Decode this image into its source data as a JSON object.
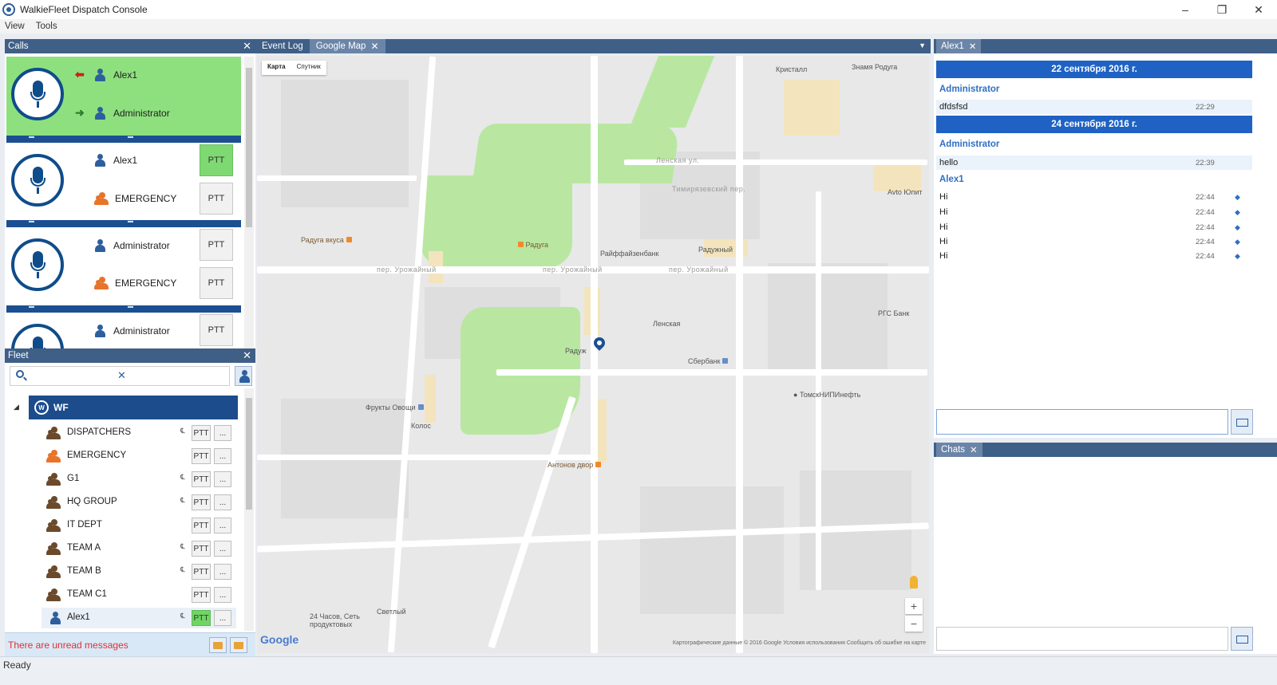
{
  "window": {
    "title": "WalkieFleet Dispatch Console"
  },
  "menu": [
    "View",
    "Tools"
  ],
  "calls": {
    "title": "Calls",
    "cards": [
      {
        "from": "Alex1",
        "to": "Administrator",
        "state": "active"
      },
      {
        "from": "Alex1",
        "to": "EMERGENCY",
        "ptt": [
          "PTT",
          "PTT"
        ]
      },
      {
        "from": "Administrator",
        "to": "EMERGENCY",
        "ptt": [
          "PTT",
          "PTT"
        ]
      },
      {
        "from": "Administrator",
        "ptt": [
          "PTT"
        ]
      }
    ]
  },
  "fleet": {
    "title": "Fleet",
    "root": "WF",
    "rows": [
      {
        "label": "DISPATCHERS",
        "ptt": "PTT",
        "more": "..."
      },
      {
        "label": "EMERGENCY",
        "ptt": "PTT",
        "more": "..."
      },
      {
        "label": "G1",
        "ptt": "PTT",
        "more": "..."
      },
      {
        "label": "HQ GROUP",
        "ptt": "PTT",
        "more": "..."
      },
      {
        "label": "IT DEPT",
        "ptt": "PTT",
        "more": "..."
      },
      {
        "label": "TEAM A",
        "ptt": "PTT",
        "more": "..."
      },
      {
        "label": "TEAM B",
        "ptt": "PTT",
        "more": "..."
      },
      {
        "label": "TEAM C1",
        "ptt": "PTT",
        "more": "..."
      },
      {
        "label": "Alex1",
        "ptt": "PTT",
        "more": "..."
      }
    ],
    "footer": "There are unread messages"
  },
  "center": {
    "tabs": [
      "Event Log",
      "Google Map"
    ],
    "map_type": [
      "Карта",
      "Спутник"
    ],
    "labels": {
      "kristall": "Кристалл",
      "znamya": "Знамя Родуга",
      "raduga_vkusa": "Радуга вкуса",
      "raduga": "Радуга",
      "raiffeisen": "Райффайзенбанк",
      "radushny": "Радужный",
      "lenskaya": "Ленская",
      "radugin": "Радуж",
      "sberbank": "Сбербанк",
      "frukty": "Фрукты Овощи",
      "kolos": "Колос",
      "antonov": "Антонов двор",
      "tomsk": "ТомскНИПИнефть",
      "avto": "Avto Юпит",
      "rgs": "РГС Банк",
      "h24": "24 Часов, Сеть продуктовых",
      "svetly": "Светлый",
      "street1": "пер. Урожайный",
      "street2": "пер. Урожайный",
      "street3": "пер. Урожайный",
      "street4": "Ленская ул.",
      "street5": "Тимирязевский пер."
    },
    "attribution": "Картографические данные © 2016 Google   Условия использования   Сообщить об ошибке на карте",
    "google": "Google",
    "zoom_in": "+",
    "zoom_out": "−"
  },
  "chat": {
    "tab": "Alex1",
    "date1": "22 сентября 2016 г.",
    "sender1": "Administrator",
    "msg1": {
      "text": "dfdsfsd",
      "time": "22:29"
    },
    "date2": "24 сентября 2016 г.",
    "sender2": "Administrator",
    "msg2": {
      "text": "hello",
      "time": "22:39"
    },
    "sender3": "Alex1",
    "msgs3": [
      {
        "text": "Hi",
        "time": "22:44"
      },
      {
        "text": "Hi",
        "time": "22:44"
      },
      {
        "text": "Hi",
        "time": "22:44"
      },
      {
        "text": "Hi",
        "time": "22:44"
      },
      {
        "text": "Hi",
        "time": "22:44"
      }
    ]
  },
  "chats": {
    "title": "Chats"
  },
  "status": "Ready",
  "icons": [
    "app-icon",
    "mic-icon",
    "person-icon",
    "group-icon",
    "search-icon",
    "clear-icon",
    "send-icon",
    "folder-icon",
    "map-pin-icon",
    "pegman-icon"
  ]
}
